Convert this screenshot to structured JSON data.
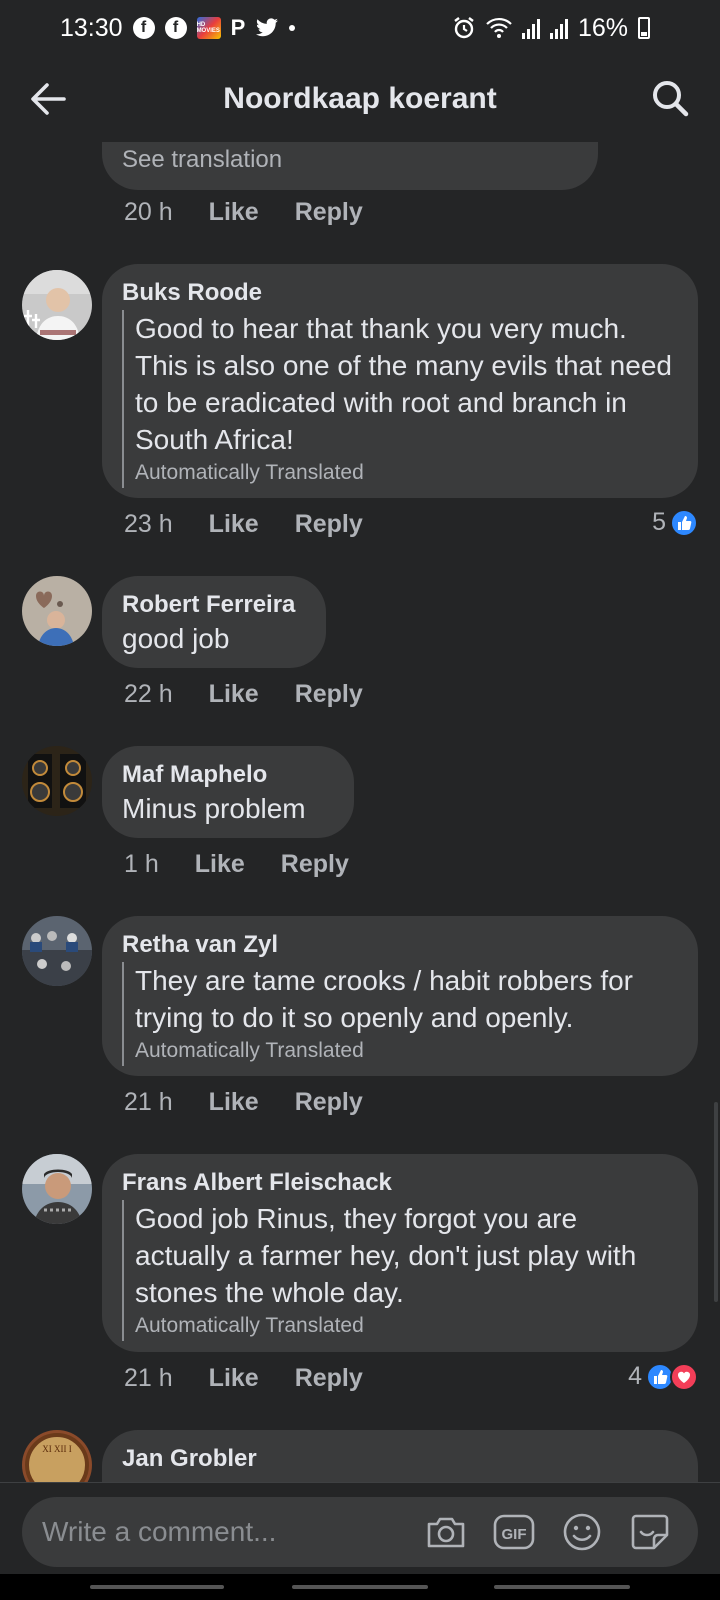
{
  "status_bar": {
    "time": "13:30",
    "movies_badge": "HD MOVIES",
    "battery": "16%"
  },
  "header": {
    "title": "Noordkaap koerant"
  },
  "comments": [
    {
      "see_translation": "See translation",
      "time": "20 h",
      "like": "Like",
      "reply": "Reply"
    },
    {
      "author": "Buks Roode",
      "text": "Good to hear that thank you very much. This is also one of the many evils that need to be eradicated with root and branch in South Africa!",
      "auto_translated": "Automatically Translated",
      "time": "23 h",
      "like": "Like",
      "reply": "Reply",
      "reaction_count": "5"
    },
    {
      "author": "Robert Ferreira",
      "text": "good job",
      "time": "22 h",
      "like": "Like",
      "reply": "Reply"
    },
    {
      "author": "Maf Maphelo",
      "text": "Minus problem",
      "time": "1 h",
      "like": "Like",
      "reply": "Reply"
    },
    {
      "author": "Retha van Zyl",
      "text": "They are tame crooks / habit robbers for trying to do it so openly and openly.",
      "auto_translated": "Automatically Translated",
      "time": "21 h",
      "like": "Like",
      "reply": "Reply"
    },
    {
      "author": "Frans Albert Fleischack",
      "text": "Good job Rinus, they forgot you are actually a farmer hey, don't just play with stones the whole day.",
      "auto_translated": "Automatically Translated",
      "time": "21 h",
      "like": "Like",
      "reply": "Reply",
      "reaction_count": "4"
    },
    {
      "author": "Jan Grobler"
    }
  ],
  "composer": {
    "placeholder": "Write a comment...",
    "gif_label": "GIF"
  },
  "icons": {
    "back": "arrow-left-icon",
    "search": "search-icon",
    "camera": "camera-icon",
    "gif": "gif-icon",
    "emoji": "emoji-icon",
    "sticker": "sticker-icon",
    "like_reaction": "thumbs-up-icon",
    "love_reaction": "heart-icon"
  },
  "colors": {
    "background": "#242526",
    "bubble": "#3a3b3c",
    "like_blue": "#2d88ff",
    "love_red": "#f33e58"
  }
}
